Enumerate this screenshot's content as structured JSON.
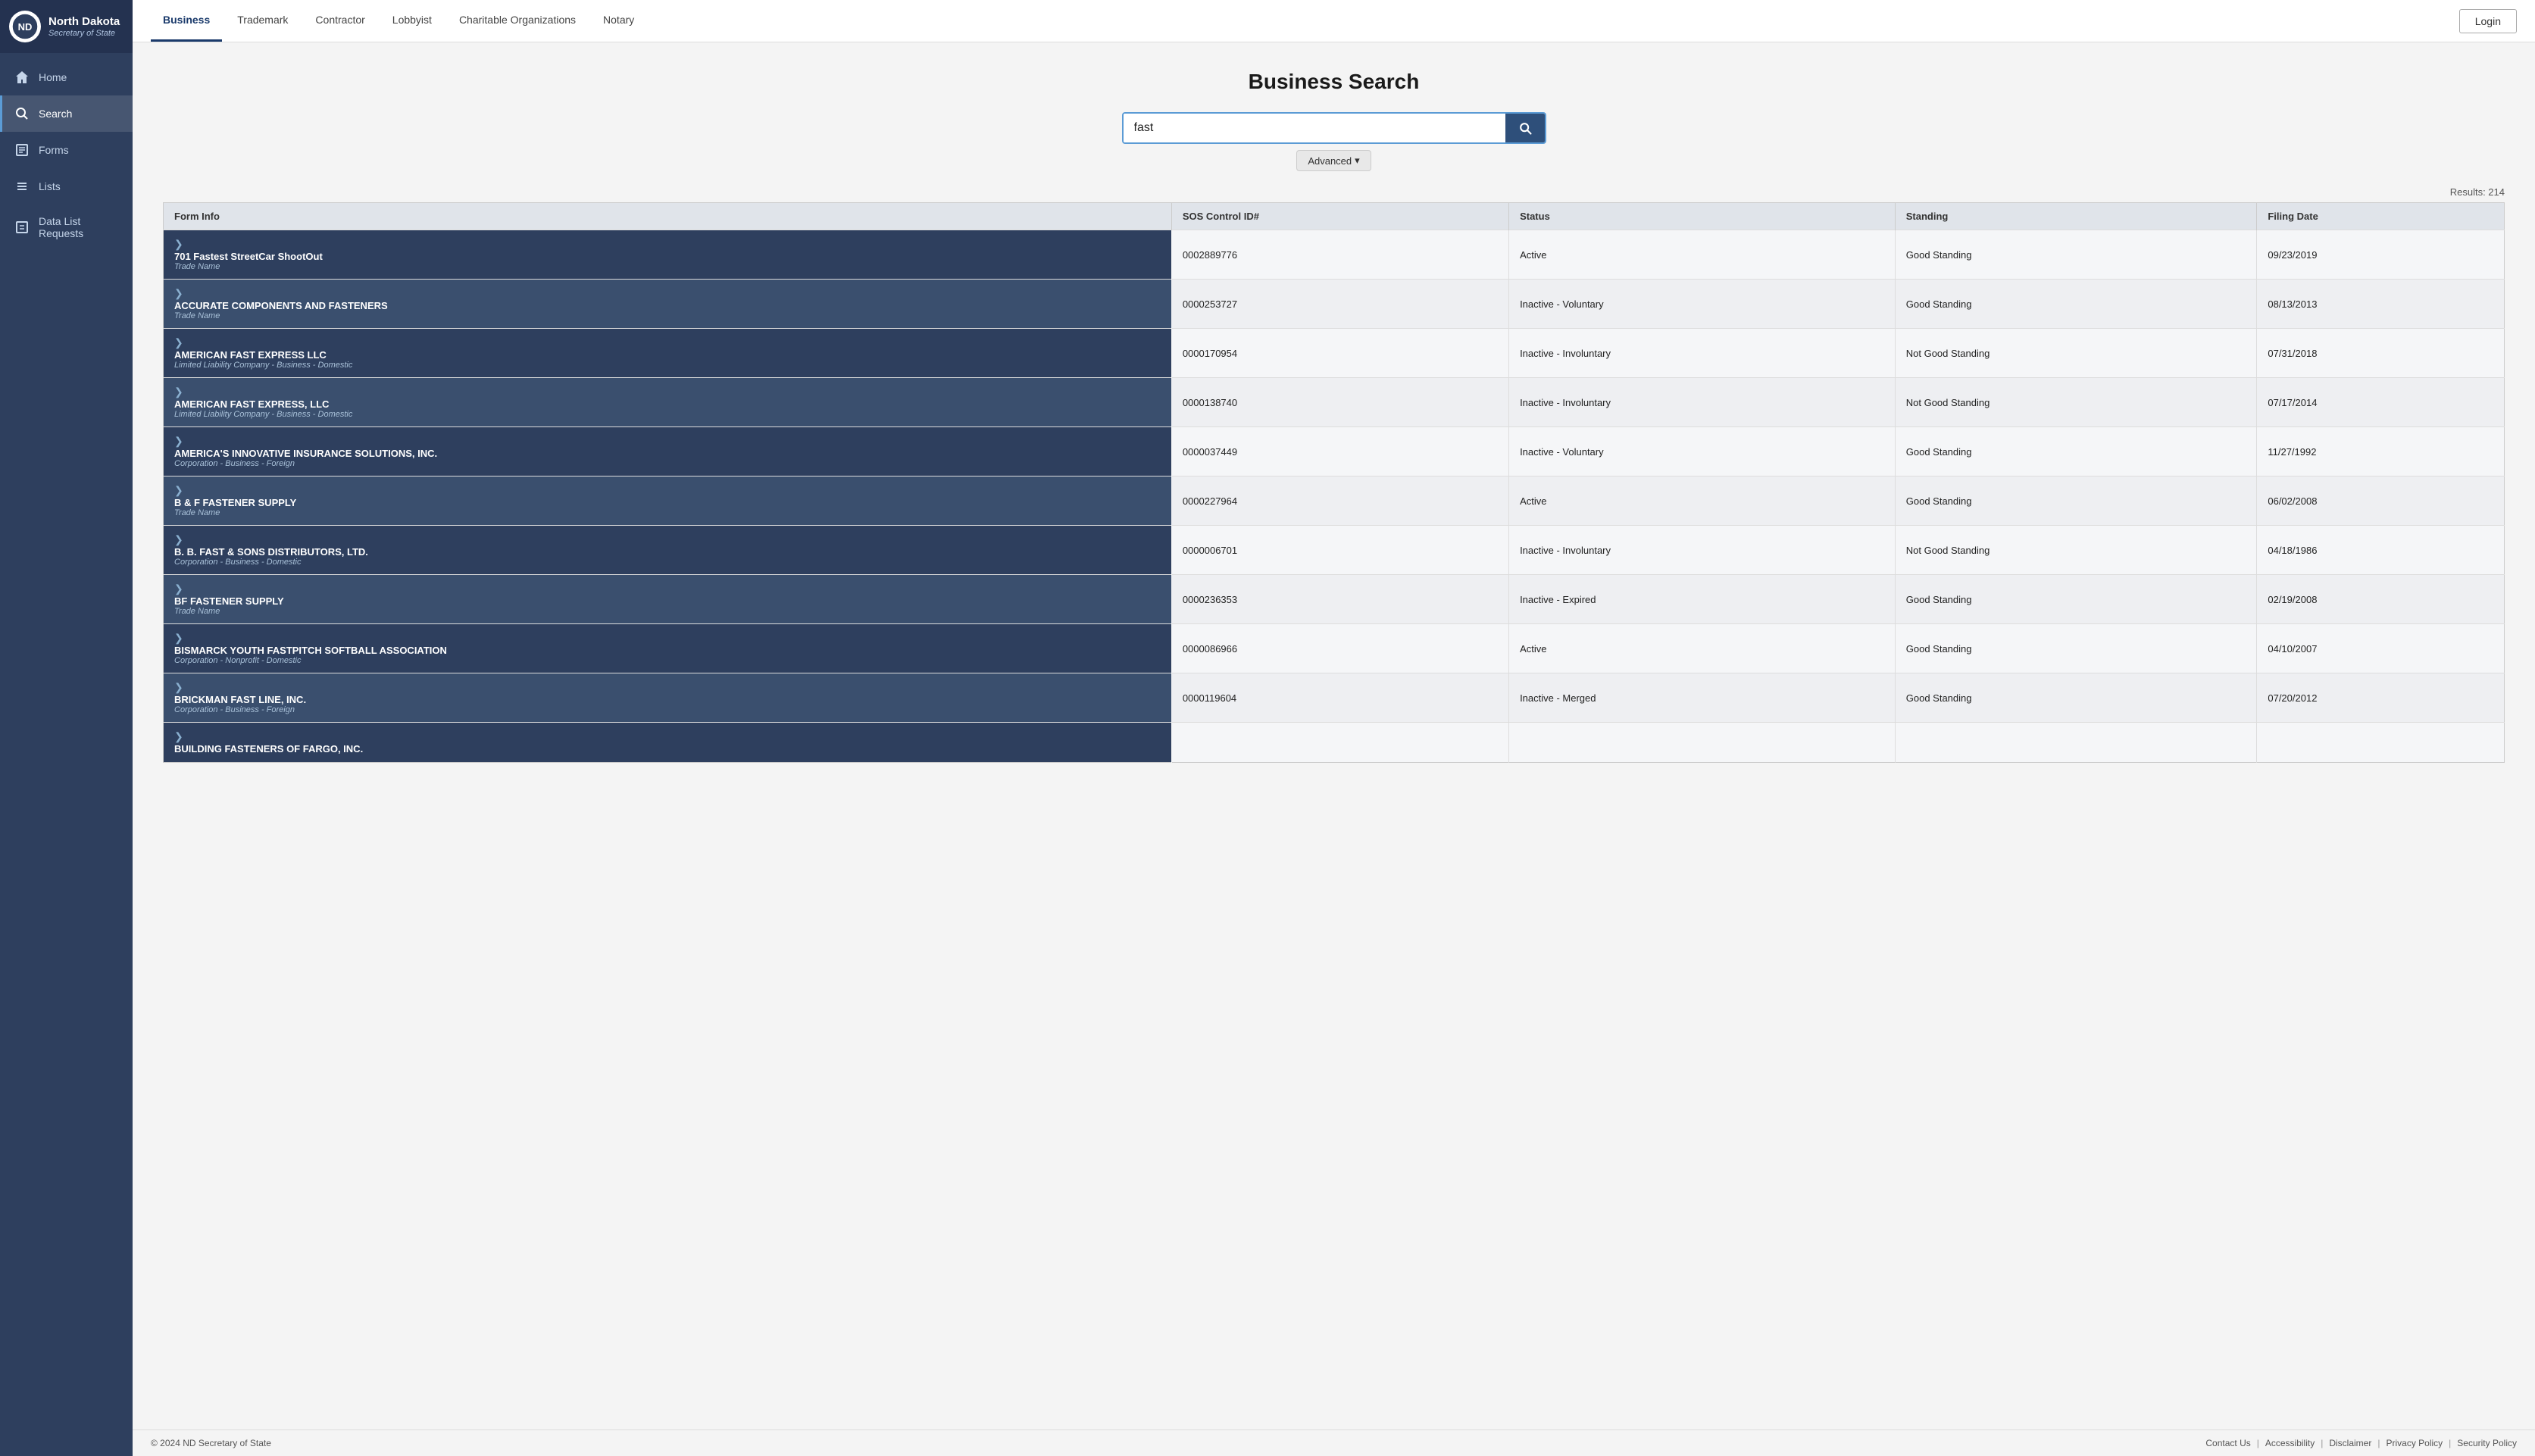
{
  "sidebar": {
    "logo_title": "North Dakota",
    "logo_sub": "Secretary of State",
    "nav_items": [
      {
        "id": "home",
        "label": "Home",
        "icon": "home"
      },
      {
        "id": "search",
        "label": "Search",
        "icon": "search",
        "active": true
      },
      {
        "id": "forms",
        "label": "Forms",
        "icon": "forms"
      },
      {
        "id": "lists",
        "label": "Lists",
        "icon": "lists"
      },
      {
        "id": "data-list-requests",
        "label": "Data List Requests",
        "icon": "data-list"
      }
    ]
  },
  "top_nav": {
    "tabs": [
      {
        "id": "business",
        "label": "Business",
        "active": true
      },
      {
        "id": "trademark",
        "label": "Trademark"
      },
      {
        "id": "contractor",
        "label": "Contractor"
      },
      {
        "id": "lobbyist",
        "label": "Lobbyist"
      },
      {
        "id": "charitable",
        "label": "Charitable Organizations"
      },
      {
        "id": "notary",
        "label": "Notary"
      }
    ],
    "login_label": "Login"
  },
  "page": {
    "title": "Business Search",
    "search_value": "fast",
    "search_placeholder": "Search...",
    "advanced_label": "Advanced",
    "results_count": "Results: 214"
  },
  "table": {
    "columns": [
      "Form Info",
      "SOS Control ID#",
      "Status",
      "Standing",
      "Filing Date"
    ],
    "rows": [
      {
        "name": "701 Fastest StreetCar ShootOut",
        "type": "Trade Name",
        "sos_id": "0002889776",
        "status": "Active",
        "standing": "Good Standing",
        "filing_date": "09/23/2019"
      },
      {
        "name": "ACCURATE COMPONENTS AND FASTENERS",
        "type": "Trade Name",
        "sos_id": "0000253727",
        "status": "Inactive - Voluntary",
        "standing": "Good Standing",
        "filing_date": "08/13/2013"
      },
      {
        "name": "AMERICAN FAST EXPRESS LLC",
        "type": "Limited Liability Company - Business - Domestic",
        "sos_id": "0000170954",
        "status": "Inactive - Involuntary",
        "standing": "Not Good Standing",
        "filing_date": "07/31/2018"
      },
      {
        "name": "AMERICAN FAST EXPRESS, LLC",
        "type": "Limited Liability Company - Business - Domestic",
        "sos_id": "0000138740",
        "status": "Inactive - Involuntary",
        "standing": "Not Good Standing",
        "filing_date": "07/17/2014"
      },
      {
        "name": "AMERICA'S INNOVATIVE INSURANCE SOLUTIONS, INC.",
        "type": "Corporation - Business - Foreign",
        "sos_id": "0000037449",
        "status": "Inactive - Voluntary",
        "standing": "Good Standing",
        "filing_date": "11/27/1992"
      },
      {
        "name": "B & F FASTENER SUPPLY",
        "type": "Trade Name",
        "sos_id": "0000227964",
        "status": "Active",
        "standing": "Good Standing",
        "filing_date": "06/02/2008"
      },
      {
        "name": "B. B. FAST & SONS DISTRIBUTORS, LTD.",
        "type": "Corporation - Business - Domestic",
        "sos_id": "0000006701",
        "status": "Inactive - Involuntary",
        "standing": "Not Good Standing",
        "filing_date": "04/18/1986"
      },
      {
        "name": "BF FASTENER SUPPLY",
        "type": "Trade Name",
        "sos_id": "0000236353",
        "status": "Inactive - Expired",
        "standing": "Good Standing",
        "filing_date": "02/19/2008"
      },
      {
        "name": "BISMARCK YOUTH FASTPITCH SOFTBALL ASSOCIATION",
        "type": "Corporation - Nonprofit - Domestic",
        "sos_id": "0000086966",
        "status": "Active",
        "standing": "Good Standing",
        "filing_date": "04/10/2007"
      },
      {
        "name": "BRICKMAN FAST LINE, INC.",
        "type": "Corporation - Business - Foreign",
        "sos_id": "0000119604",
        "status": "Inactive - Merged",
        "standing": "Good Standing",
        "filing_date": "07/20/2012"
      },
      {
        "name": "BUILDING FASTENERS OF FARGO, INC.",
        "type": "",
        "sos_id": "",
        "status": "",
        "standing": "",
        "filing_date": ""
      }
    ]
  },
  "footer": {
    "copyright": "© 2024 ND Secretary of State",
    "links": [
      "Contact Us",
      "Accessibility",
      "Disclaimer",
      "Privacy Policy",
      "Security Policy"
    ]
  }
}
